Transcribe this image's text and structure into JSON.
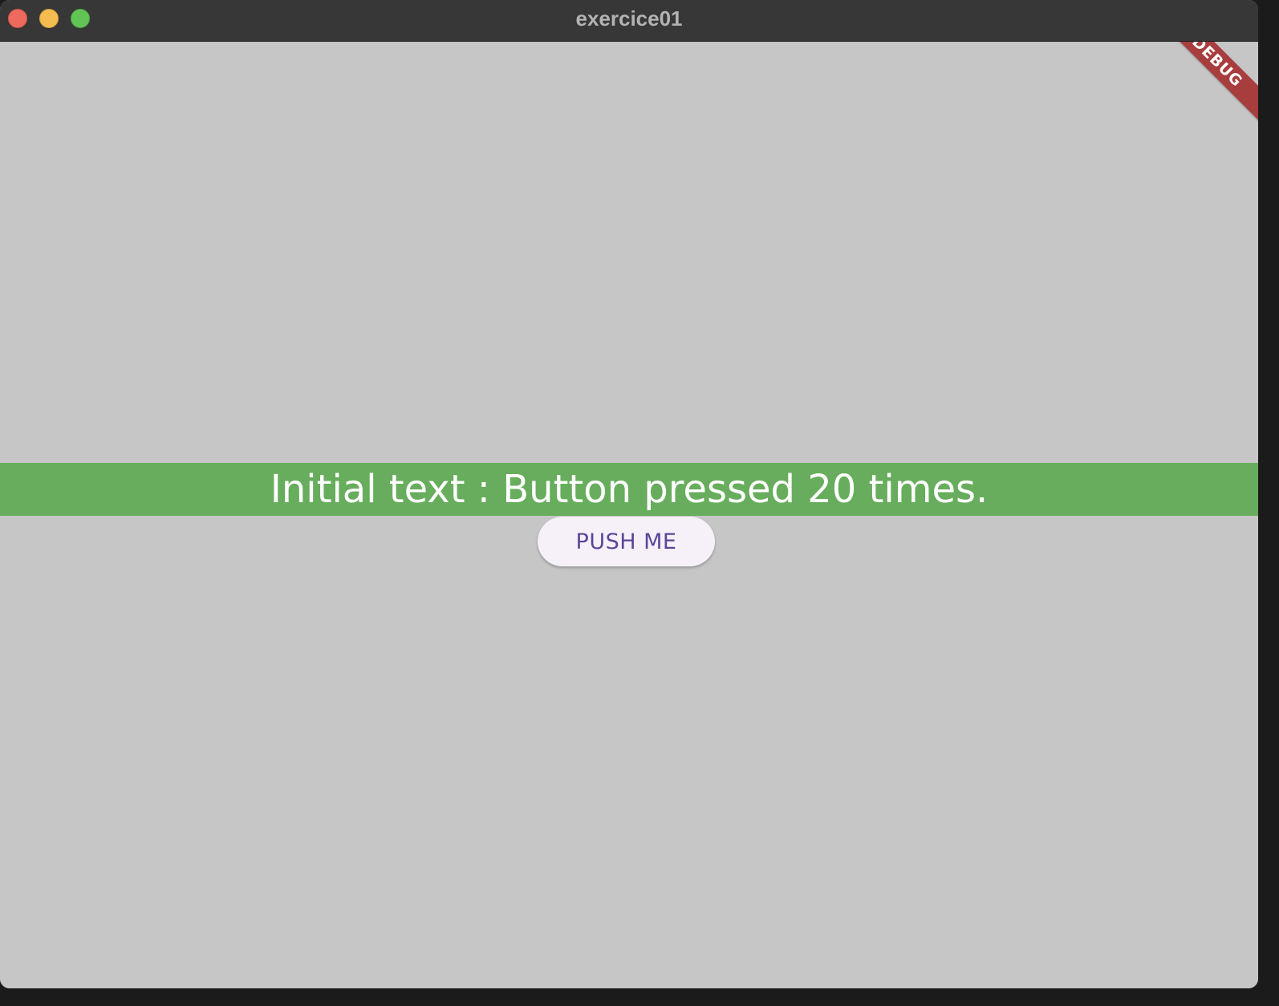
{
  "window": {
    "title": "exercice01"
  },
  "banner": {
    "text": "Initial text : Button pressed 20 times.",
    "color": "#68ad5d"
  },
  "button": {
    "label": "PUSH ME"
  },
  "debug_banner": {
    "label": "DEBUG"
  },
  "colors": {
    "background": "#c6c6c6",
    "titlebar": "#373737",
    "button_text": "#5b4597",
    "debug_ribbon": "#a83d3d"
  }
}
